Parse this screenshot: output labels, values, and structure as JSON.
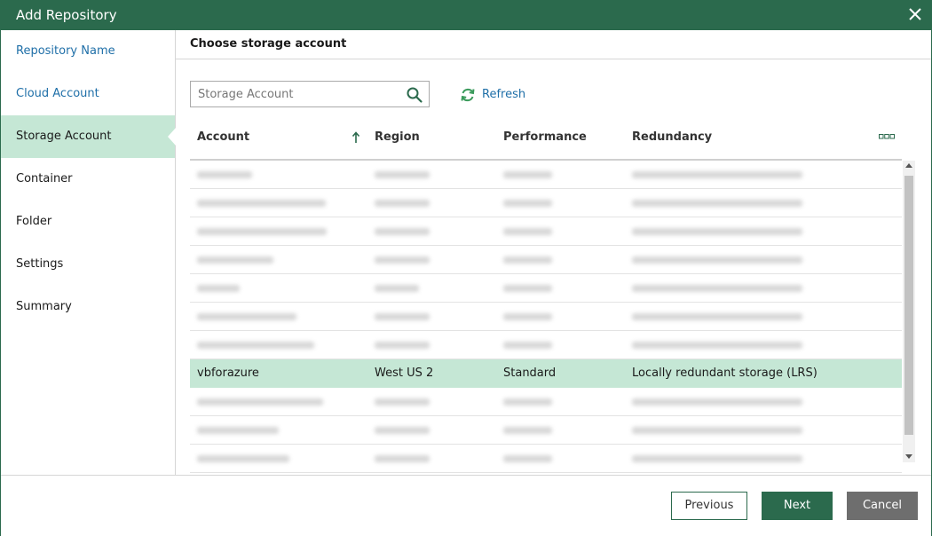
{
  "window": {
    "title": "Add Repository"
  },
  "sidebar": {
    "items": [
      {
        "label": "Repository Name",
        "state": "link"
      },
      {
        "label": "Cloud Account",
        "state": "link"
      },
      {
        "label": "Storage Account",
        "state": "active"
      },
      {
        "label": "Container",
        "state": "normal"
      },
      {
        "label": "Folder",
        "state": "normal"
      },
      {
        "label": "Settings",
        "state": "normal"
      },
      {
        "label": "Summary",
        "state": "normal"
      }
    ]
  },
  "main": {
    "heading": "Choose storage account",
    "search": {
      "placeholder": "Storage Account",
      "value": ""
    },
    "refresh_label": "Refresh",
    "table": {
      "columns": [
        "Account",
        "Region",
        "Performance",
        "Redundancy"
      ],
      "sort": {
        "column": "Account",
        "direction": "ascending"
      },
      "selected_row": {
        "account": "vbforazure",
        "region": "West US 2",
        "performance": "Standard",
        "redundancy": "Locally redundant storage (LRS)"
      },
      "blurred_rows_above": 7,
      "blurred_rows_below": 3
    }
  },
  "footer": {
    "previous_label": "Previous",
    "next_label": "Next",
    "cancel_label": "Cancel"
  },
  "colors": {
    "brand": "#2b6a4d",
    "selection": "#c5e7d5",
    "link": "#1f6fa8",
    "cancel": "#6e6e6e"
  },
  "icons": {
    "close": "close-icon",
    "search": "search-icon",
    "refresh": "refresh-icon",
    "sort": "sort-ascending-icon",
    "more": "column-chooser-icon"
  }
}
